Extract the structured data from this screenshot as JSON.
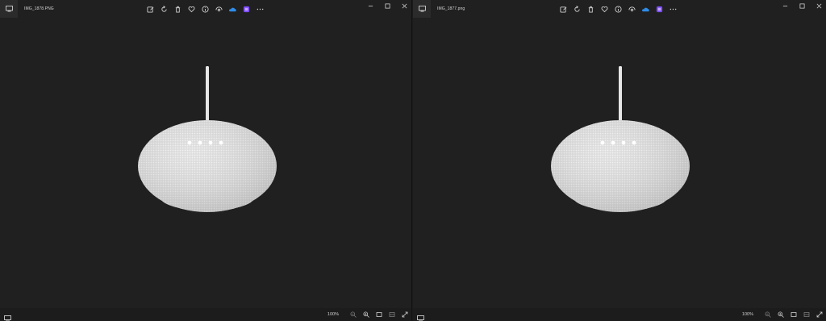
{
  "windows": [
    {
      "file_name": "IMG_1878.PNG",
      "zoom": "100%",
      "toolbar_icons": [
        "edit-image-icon",
        "rotate-icon",
        "delete-icon",
        "favorite-icon",
        "info-icon",
        "visual-search-icon",
        "onedrive-icon",
        "clipchamp-icon",
        "more-options-icon"
      ]
    },
    {
      "file_name": "IMG_1877.png",
      "zoom": "100%",
      "toolbar_icons": [
        "edit-image-icon",
        "rotate-icon",
        "delete-icon",
        "favorite-icon",
        "info-icon",
        "visual-search-icon",
        "onedrive-icon",
        "clipchamp-icon",
        "more-options-icon"
      ]
    }
  ],
  "colors": {
    "background": "#202020",
    "statusbar": "#1c1c1c",
    "speaker_fabric": "#e6e6e6",
    "onedrive_accent": "#2f8ce8",
    "clipchamp_accent": "#7b4dff"
  }
}
